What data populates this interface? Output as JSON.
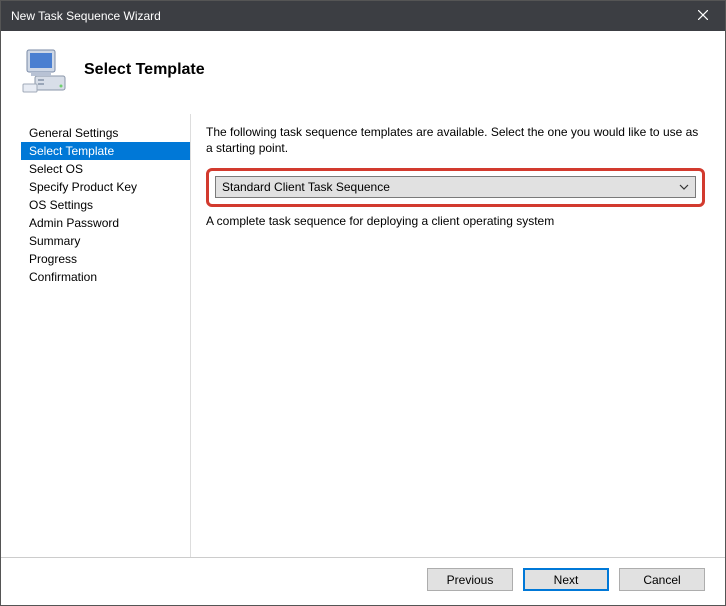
{
  "titlebar": {
    "title": "New Task Sequence Wizard"
  },
  "header": {
    "title": "Select Template"
  },
  "sidebar": {
    "items": [
      {
        "label": "General Settings"
      },
      {
        "label": "Select Template"
      },
      {
        "label": "Select OS"
      },
      {
        "label": "Specify Product Key"
      },
      {
        "label": "OS Settings"
      },
      {
        "label": "Admin Password"
      },
      {
        "label": "Summary"
      },
      {
        "label": "Progress"
      },
      {
        "label": "Confirmation"
      }
    ],
    "selected_index": 1
  },
  "main": {
    "instruction": "The following task sequence templates are available.  Select the one you would like to use as a starting point.",
    "dropdown_selected": "Standard Client Task Sequence",
    "description": "A complete task sequence for deploying a client operating system"
  },
  "footer": {
    "previous": "Previous",
    "next": "Next",
    "cancel": "Cancel"
  }
}
